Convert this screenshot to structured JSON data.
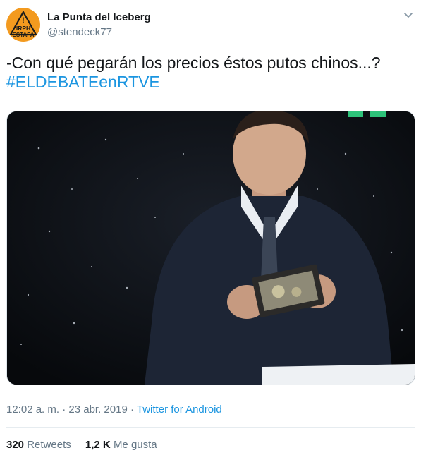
{
  "tweet": {
    "author": {
      "display_name": "La Punta del Iceberg",
      "handle": "@stendeck77",
      "avatar": {
        "line1": "IRPH",
        "line2": "ESTAFA",
        "mark": "!"
      }
    },
    "text": "-Con qué pegarán los precios éstos putos chinos...?",
    "hashtag": "#ELDEBATEenRTVE",
    "time": "12:02 a. m.",
    "separator": "·",
    "date": "23 abr. 2019",
    "source": "Twitter for Android",
    "retweets": {
      "count": "320",
      "label": "Retweets"
    },
    "likes": {
      "count": "1,2 K",
      "label": "Me gusta"
    }
  },
  "colors": {
    "link": "#1b95e0",
    "muted": "#657786",
    "text": "#14171a",
    "avatar_orange": "#f39a1f",
    "divider": "#e6ecf0"
  },
  "icons": {
    "caret": "chevron-down-icon",
    "avatar": "warning-triangle-avatar"
  }
}
